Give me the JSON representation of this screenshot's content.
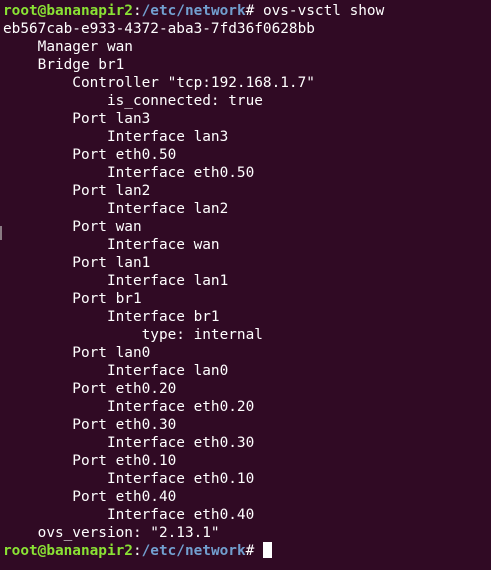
{
  "prompt": {
    "user_host": "root@bananapir2",
    "separator": ":",
    "path": "/etc/network",
    "symbol": "# "
  },
  "command": "ovs-vsctl show",
  "output": [
    "eb567cab-e933-4372-aba3-7fd36f0628bb",
    "    Manager wan",
    "    Bridge br1",
    "        Controller \"tcp:192.168.1.7\"",
    "            is_connected: true",
    "        Port lan3",
    "            Interface lan3",
    "        Port eth0.50",
    "            Interface eth0.50",
    "        Port lan2",
    "            Interface lan2",
    "        Port wan",
    "            Interface wan",
    "        Port lan1",
    "            Interface lan1",
    "        Port br1",
    "            Interface br1",
    "                type: internal",
    "        Port lan0",
    "            Interface lan0",
    "        Port eth0.20",
    "            Interface eth0.20",
    "        Port eth0.30",
    "            Interface eth0.30",
    "        Port eth0.10",
    "            Interface eth0.10",
    "        Port eth0.40",
    "            Interface eth0.40",
    "    ovs_version: \"2.13.1\""
  ]
}
